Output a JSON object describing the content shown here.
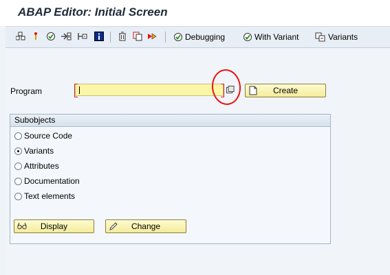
{
  "window": {
    "title": "ABAP Editor: Initial Screen"
  },
  "toolbar": {
    "icons": [
      "object-list-icon",
      "where-used-icon",
      "check-icon",
      "activate-icon",
      "test-icon",
      "info-icon",
      "delete-icon",
      "copy-icon",
      "rename-icon"
    ],
    "debugging_label": "Debugging",
    "with_variant_label": "With Variant",
    "variants_label": "Variants"
  },
  "program": {
    "label": "Program",
    "value": "",
    "create_label": "Create"
  },
  "subobjects": {
    "title": "Subobjects",
    "options": [
      {
        "label": "Source Code",
        "selected": false
      },
      {
        "label": "Variants",
        "selected": true
      },
      {
        "label": "Attributes",
        "selected": false
      },
      {
        "label": "Documentation",
        "selected": false
      },
      {
        "label": "Text elements",
        "selected": false
      }
    ],
    "display_label": "Display",
    "change_label": "Change"
  },
  "colors": {
    "required_field_bg": "#fbf5a8",
    "button_bg": "#f4ec9a",
    "annotation_circle": "#e11111"
  }
}
